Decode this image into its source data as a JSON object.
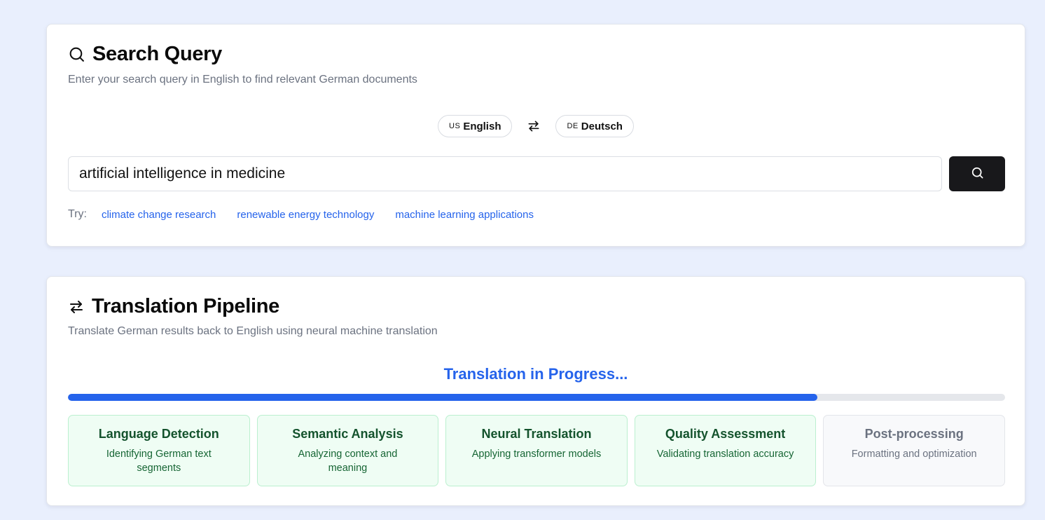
{
  "search": {
    "title": "Search Query",
    "subtitle": "Enter your search query in English to find relevant German documents",
    "source_lang": {
      "code": "US",
      "label": "English"
    },
    "target_lang": {
      "code": "DE",
      "label": "Deutsch"
    },
    "query": "artificial intelligence in medicine",
    "try_label": "Try:",
    "suggestions": [
      "climate change research",
      "renewable energy technology",
      "machine learning applications"
    ]
  },
  "pipeline": {
    "title": "Translation Pipeline",
    "subtitle": "Translate German results back to English using neural machine translation",
    "status": "Translation in Progress...",
    "progress": 0.8,
    "steps": [
      {
        "title": "Language Detection",
        "desc": "Identifying German text segments",
        "state": "complete"
      },
      {
        "title": "Semantic Analysis",
        "desc": "Analyzing context and meaning",
        "state": "complete"
      },
      {
        "title": "Neural Translation",
        "desc": "Applying transformer models",
        "state": "complete"
      },
      {
        "title": "Quality Assessment",
        "desc": "Validating translation accuracy",
        "state": "complete"
      },
      {
        "title": "Post-processing",
        "desc": "Formatting and optimization",
        "state": "pending"
      }
    ]
  },
  "colors": {
    "accent": "#2563eb",
    "background": "#e9effd",
    "complete_bg": "#effdf4",
    "complete_text": "#14532d",
    "search_button": "#18181b"
  }
}
